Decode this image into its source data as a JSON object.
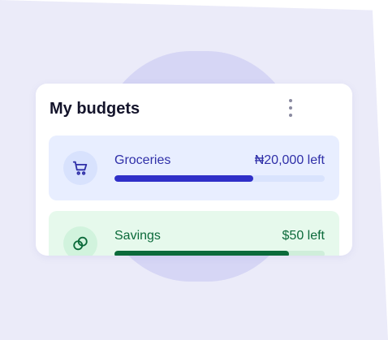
{
  "card": {
    "title": "My budgets",
    "menu_icon": "more-vertical-icon"
  },
  "budgets": [
    {
      "label": "Groceries",
      "amount": "₦20,000 left",
      "icon": "shopping-cart-icon",
      "progress": 0.66,
      "accent": "#2f2fc8"
    },
    {
      "label": "Savings",
      "amount": "$50 left",
      "icon": "coins-icon",
      "progress": 0.83,
      "accent": "#0b6a3a"
    }
  ]
}
